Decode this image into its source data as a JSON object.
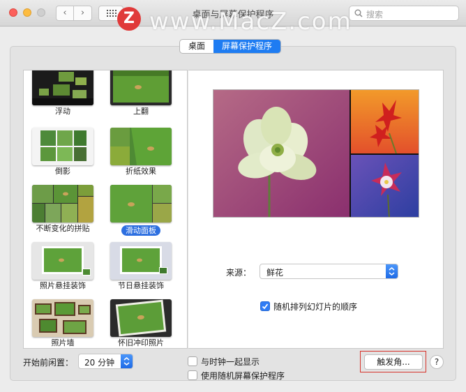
{
  "window": {
    "title": "桌面与屏幕保护程序"
  },
  "search": {
    "placeholder": "搜索"
  },
  "watermark": {
    "logo": "Z",
    "text": "www.MacZ.com"
  },
  "tabs": [
    {
      "label": "桌面",
      "active": false
    },
    {
      "label": "屏幕保护程序",
      "active": true
    }
  ],
  "screensavers": [
    {
      "label": "浮动",
      "selected": false
    },
    {
      "label": "上翻",
      "selected": false
    },
    {
      "label": "倒影",
      "selected": false
    },
    {
      "label": "折纸效果",
      "selected": false
    },
    {
      "label": "不断变化的拼贴",
      "selected": false
    },
    {
      "label": "滑动面板",
      "selected": true
    },
    {
      "label": "照片悬挂装饰",
      "selected": false
    },
    {
      "label": "节日悬挂装饰",
      "selected": false
    },
    {
      "label": "照片墙",
      "selected": false
    },
    {
      "label": "怀旧冲印照片",
      "selected": false
    }
  ],
  "source": {
    "label": "来源：",
    "value": "鲜花"
  },
  "shuffle": {
    "label": "随机排列幻灯片的顺序",
    "checked": true
  },
  "idle": {
    "label": "开始前闲置：",
    "value": "20 分钟"
  },
  "show_clock": {
    "label": "与时钟一起显示",
    "checked": false
  },
  "random_saver": {
    "label": "使用随机屏幕保护程序",
    "checked": false
  },
  "hot_corners": {
    "label": "触发角..."
  },
  "help": {
    "label": "?"
  },
  "colors": {
    "accent": "#1e7cf2",
    "highlight_outline": "#d7322a"
  }
}
